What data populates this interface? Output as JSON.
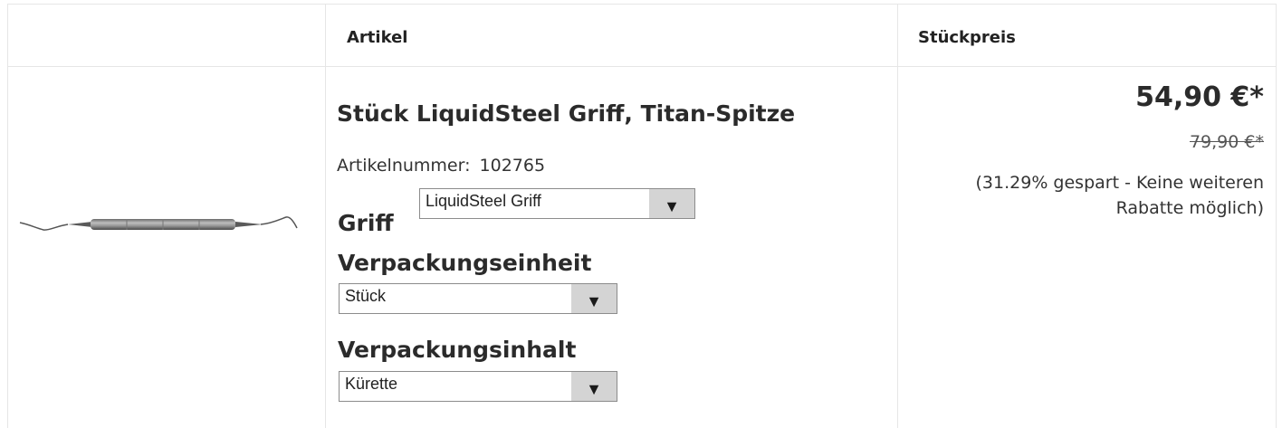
{
  "header": {
    "col_image": "",
    "col_article": "Artikel",
    "col_price": "Stückpreis"
  },
  "product": {
    "title": "Stück LiquidSteel Griff, Titan-Spitze",
    "article_number_label": "Artikelnummer:",
    "article_number": "102765",
    "image_icon": "dental-curette-instrument"
  },
  "options": {
    "griff": {
      "label": "Griff",
      "selected": "LiquidSteel Griff"
    },
    "verpackungseinheit": {
      "label": "Verpackungseinheit",
      "selected": "Stück"
    },
    "verpackungsinhalt": {
      "label": "Verpackungsinhalt",
      "selected": "Kürette"
    }
  },
  "pricing": {
    "price": "54,90 €*",
    "old_price": "79,90 €*",
    "saving_note": "(31.29% gespart - Keine weiteren Rabatte möglich)"
  },
  "colors": {
    "border": "#e6e6e6",
    "select_button": "#d4d4d4"
  }
}
